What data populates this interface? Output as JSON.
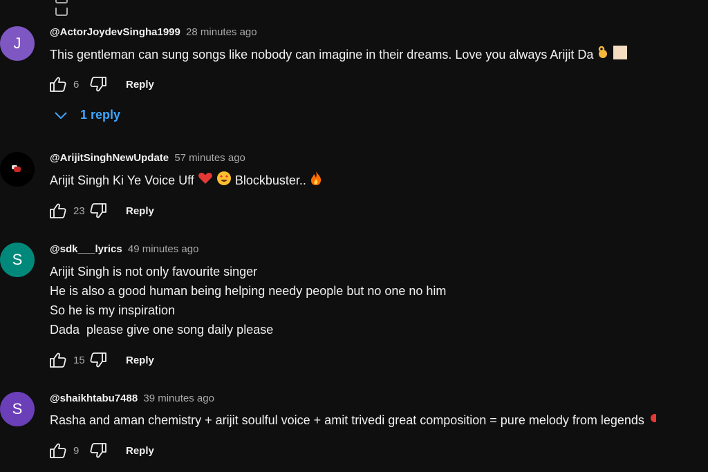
{
  "comments": [
    {
      "avatar_letter": "J",
      "handle": "@ActorJoydevSingha1999",
      "time": "28 minutes ago",
      "text": "This gentleman can sung songs like nobody can imagine in their dreams. Love you always Arijit Da",
      "likes": "6",
      "reply_label": "Reply",
      "replies_label": "1 reply"
    },
    {
      "avatar_letter": "",
      "handle": "@ArijitSinghNewUpdate",
      "time": "57 minutes ago",
      "text": "Arijit Singh Ki Ye Voice Uff",
      "text_after": "Blockbuster..",
      "likes": "23",
      "reply_label": "Reply"
    },
    {
      "avatar_letter": "S",
      "handle": "@sdk___lyrics",
      "time": "49 minutes ago",
      "lines": [
        "Arijit Singh is not only favourite singer",
        "He is also a good human being helping needy people but no one no him",
        "So he is my inspiration",
        "Dada  please give one song daily please"
      ],
      "likes": "15",
      "reply_label": "Reply"
    },
    {
      "avatar_letter": "S",
      "handle": "@shaikhtabu7488",
      "time": "39 minutes ago",
      "text": "Rasha and aman chemistry + arijit soulful voice + amit trivedi great composition = pure melody from legends",
      "likes": "9",
      "reply_label": "Reply"
    }
  ],
  "colors": {
    "background": "#0f0f0f",
    "link_blue": "#3ea6ff",
    "avatar_j": "#7e57c2",
    "avatar_s1": "#00897b",
    "avatar_s2": "#6a3fb8"
  },
  "icons": [
    "like-icon",
    "dislike-icon",
    "chevron-down-icon"
  ]
}
